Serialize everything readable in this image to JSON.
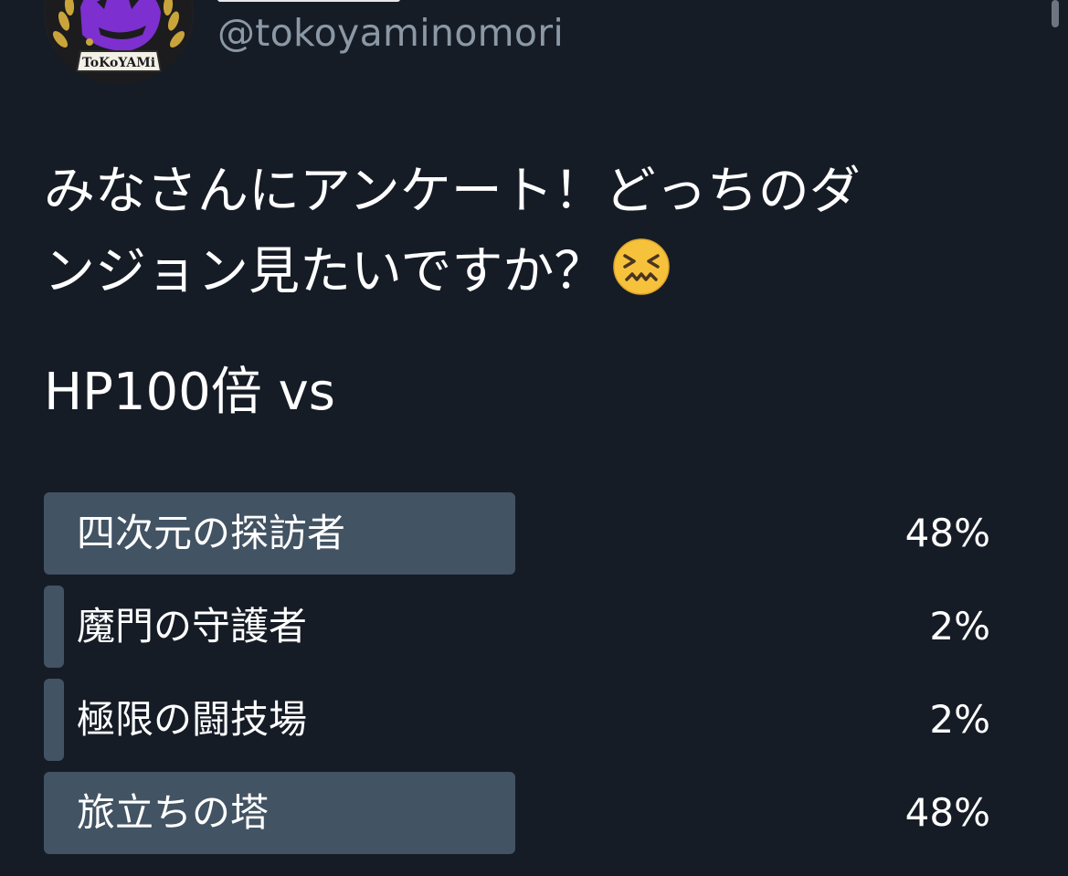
{
  "header": {
    "handle": "@tokoyaminomori",
    "avatar_logo_text": "ToKoYAMi"
  },
  "tweet": {
    "line1": "みなさんにアンケート！どっちのダ",
    "line2": "ンジョン見たいですか？",
    "emoji": "confounded-face-emoji",
    "line3": "HP100倍 vs"
  },
  "poll": {
    "bar_color": "#425363",
    "options": [
      {
        "label": "四次元の探訪者",
        "percent_text": "48%",
        "percent": 48
      },
      {
        "label": "魔門の守護者",
        "percent_text": "2%",
        "percent": 2
      },
      {
        "label": "極限の闘技場",
        "percent_text": "2%",
        "percent": 2
      },
      {
        "label": "旅立ちの塔",
        "percent_text": "48%",
        "percent": 48
      }
    ]
  }
}
